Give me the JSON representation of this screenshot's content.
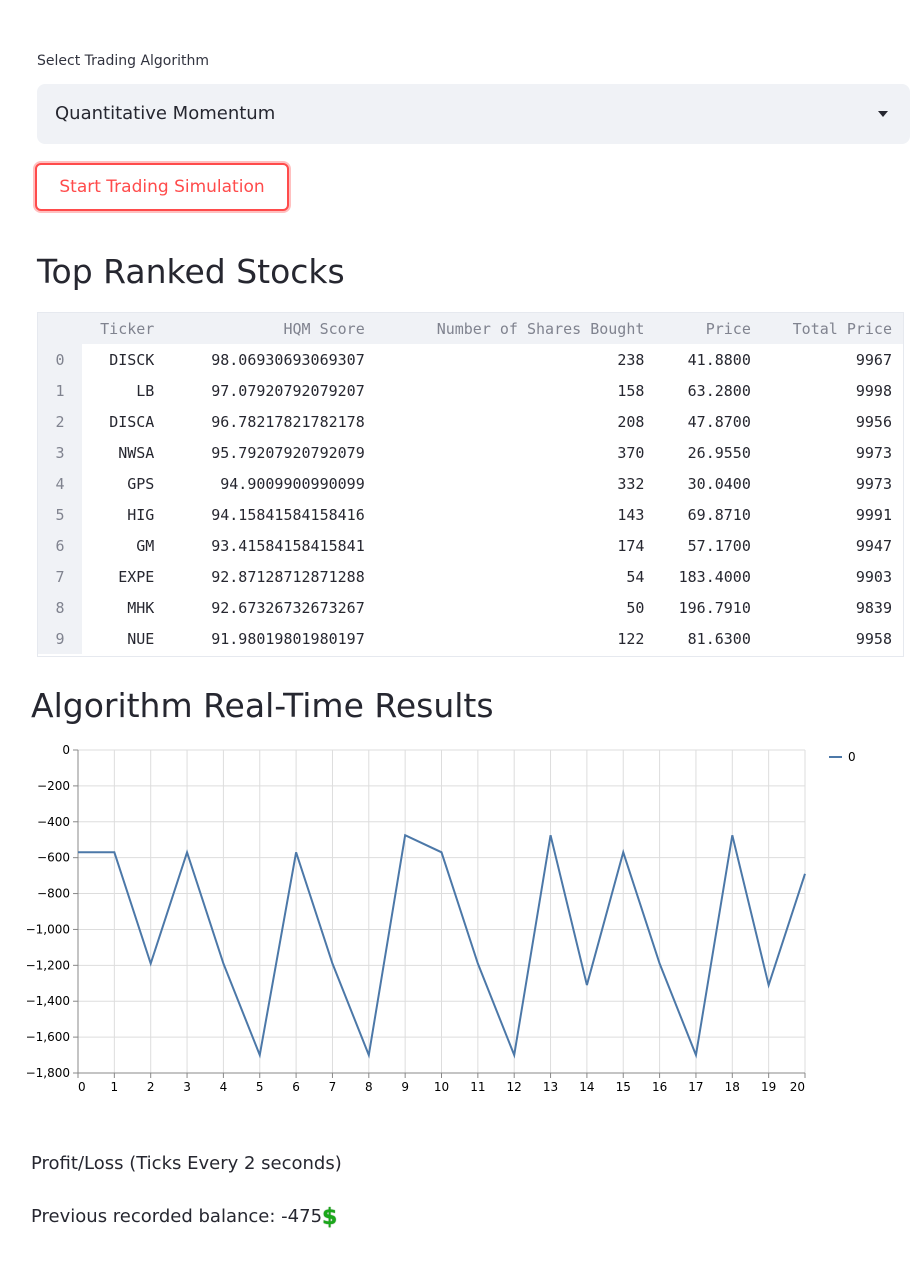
{
  "select": {
    "label": "Select Trading Algorithm",
    "value": "Quantitative Momentum"
  },
  "button": {
    "label": "Start Trading Simulation"
  },
  "top_title": "Top Ranked Stocks",
  "table": {
    "headers": [
      "",
      "Ticker",
      "HQM Score",
      "Number of Shares Bought",
      "Price",
      "Total Price"
    ],
    "rows": [
      [
        "0",
        "DISCK",
        "98.06930693069307",
        "238",
        "41.8800",
        "9967"
      ],
      [
        "1",
        "LB",
        "97.07920792079207",
        "158",
        "63.2800",
        "9998"
      ],
      [
        "2",
        "DISCA",
        "96.78217821782178",
        "208",
        "47.8700",
        "9956"
      ],
      [
        "3",
        "NWSA",
        "95.79207920792079",
        "370",
        "26.9550",
        "9973"
      ],
      [
        "4",
        "GPS",
        "94.9009900990099",
        "332",
        "30.0400",
        "9973"
      ],
      [
        "5",
        "HIG",
        "94.15841584158416",
        "143",
        "69.8710",
        "9991"
      ],
      [
        "6",
        "GM",
        "93.41584158415841",
        "174",
        "57.1700",
        "9947"
      ],
      [
        "7",
        "EXPE",
        "92.87128712871288",
        "54",
        "183.4000",
        "9903"
      ],
      [
        "8",
        "MHK",
        "92.67326732673267",
        "50",
        "196.7910",
        "9839"
      ],
      [
        "9",
        "NUE",
        "91.98019801980197",
        "122",
        "81.6300",
        "9958"
      ]
    ]
  },
  "chart_title": "Algorithm Real-Time Results",
  "chart_data": {
    "type": "line",
    "x": [
      0,
      1,
      2,
      3,
      4,
      5,
      6,
      7,
      8,
      9,
      10,
      11,
      12,
      13,
      14,
      15,
      16,
      17,
      18,
      19,
      20
    ],
    "series": [
      {
        "name": "0",
        "color": "#4c78a8",
        "values": [
          -570,
          -570,
          -1190,
          -570,
          -1190,
          -1700,
          -570,
          -1190,
          -1700,
          -475,
          -570,
          -1190,
          -1700,
          -475,
          -1310,
          -570,
          -1190,
          -1700,
          -475,
          -1310,
          -690
        ]
      }
    ],
    "ylim": [
      -1800,
      0
    ],
    "yticks": [
      0,
      -200,
      -400,
      -600,
      -800,
      -1000,
      -1200,
      -1400,
      -1600,
      -1800
    ],
    "ytick_labels": [
      "0",
      "−200",
      "−400",
      "−600",
      "−800",
      "−1,000",
      "−1,200",
      "−1,400",
      "−1,600",
      "−1,800"
    ],
    "xlim": [
      0,
      20
    ],
    "grid": true,
    "legend": "top-right"
  },
  "pl_label": "Profit/Loss (Ticks Every 2 seconds)",
  "balance": {
    "text": "Previous recorded balance: -475",
    "icon": "heavy-dollar-sign-icon"
  }
}
